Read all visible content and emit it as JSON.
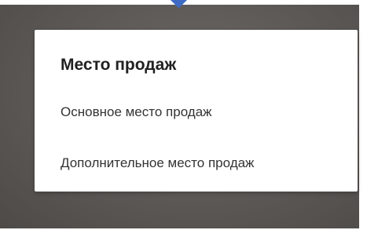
{
  "dialog": {
    "title": "Место продаж",
    "options": [
      {
        "label": "Основное место продаж"
      },
      {
        "label": "Дополнительное место продаж"
      }
    ]
  },
  "colors": {
    "backdrop": "#5c5856",
    "dialog_background": "#ffffff",
    "pointer": "#3f6bc4",
    "title_text": "#212121",
    "option_text": "#333333"
  }
}
